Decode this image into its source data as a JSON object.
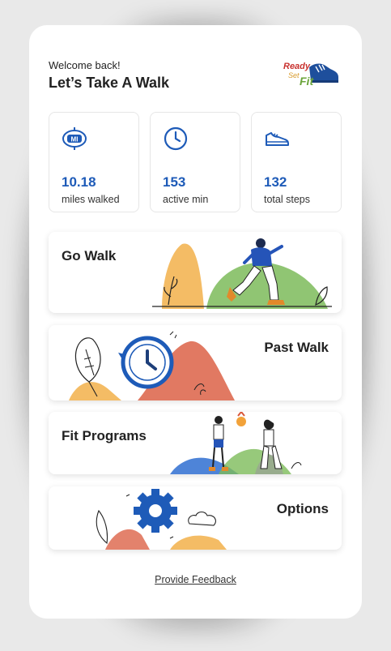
{
  "header": {
    "welcome": "Welcome back!",
    "title": "Let’s Take A Walk",
    "logo_text_ready": "Ready",
    "logo_text_set": "Set",
    "logo_text_fit": "Fit"
  },
  "stats": [
    {
      "icon": "mile-marker-icon",
      "value": "10.18",
      "label": "miles walked"
    },
    {
      "icon": "clock-icon",
      "value": "153",
      "label": "active min"
    },
    {
      "icon": "sneaker-icon",
      "value": "132",
      "label": "total steps"
    }
  ],
  "cards": [
    {
      "label": "Go Walk",
      "illustration": "walking-person"
    },
    {
      "label": "Past Walk",
      "illustration": "history-clock"
    },
    {
      "label": "Fit Programs",
      "illustration": "people-with-medal"
    },
    {
      "label": "Options",
      "illustration": "gear-and-cloud"
    }
  ],
  "mile_icon_text": "MI",
  "footer": {
    "feedback": "Provide Feedback"
  },
  "colors": {
    "accent_blue": "#1e5bb8",
    "orange": "#f2a23a",
    "green": "#6cb04a",
    "red": "#d9583b"
  }
}
